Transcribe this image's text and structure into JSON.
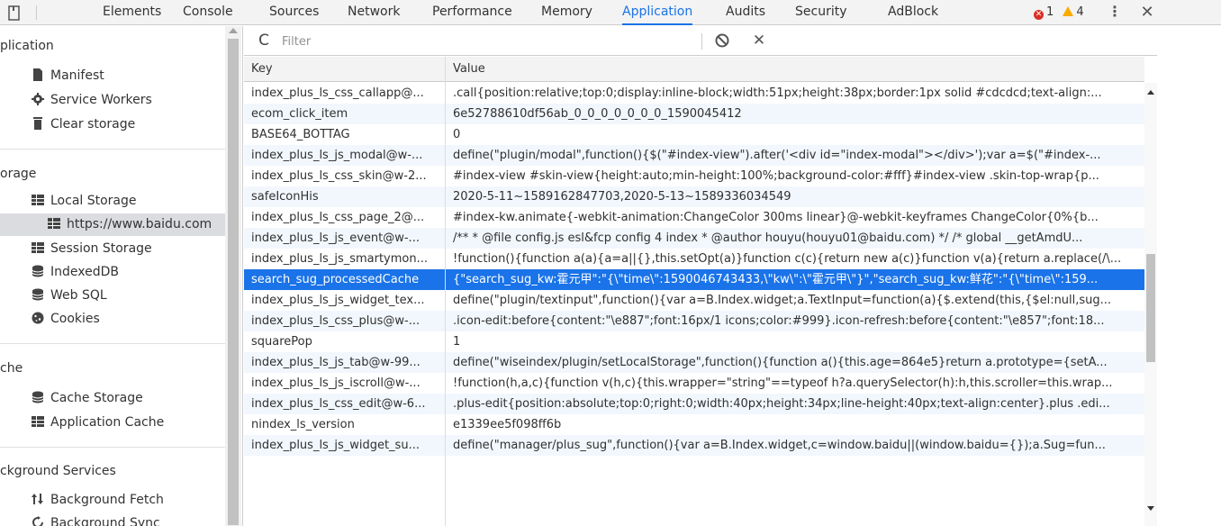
{
  "toolbar": {
    "tabs": [
      {
        "label": "Elements",
        "left": 0
      },
      {
        "label": "Console",
        "left": 0
      },
      {
        "label": "Sources",
        "left": 0
      },
      {
        "label": "Network",
        "left": 0
      },
      {
        "label": "Performance",
        "left": 0
      },
      {
        "label": "Memory",
        "left": 0
      },
      {
        "label": "Application",
        "left": 0
      },
      {
        "label": "Audits",
        "left": 0
      },
      {
        "label": "Security",
        "left": 0
      },
      {
        "label": "AdBlock",
        "left": 0
      }
    ],
    "active_tab": "Application",
    "error_count": "1",
    "warning_count": "4",
    "colors": {
      "accent": "#1a73e8",
      "error": "#d93025",
      "warning": "#f9ab00"
    }
  },
  "sidebar": {
    "sections": {
      "application": "plication",
      "storage": "orage",
      "cache": "che",
      "background_services": "ckground Services"
    },
    "items": {
      "manifest": "Manifest",
      "service_workers": "Service Workers",
      "clear_storage": "Clear storage",
      "local_storage": "Local Storage",
      "baidu_origin": "https://www.baidu.com",
      "session_storage": "Session Storage",
      "indexeddb": "IndexedDB",
      "web_sql": "Web SQL",
      "cookies": "Cookies",
      "cache_storage": "Cache Storage",
      "application_cache": "Application Cache",
      "background_fetch": "Background Fetch",
      "background_sync": "Background Sync"
    }
  },
  "filter": {
    "placeholder": "Filter"
  },
  "table": {
    "headers": {
      "key": "Key",
      "value": "Value"
    },
    "selected_index": 11,
    "rows": [
      {
        "key": "index_plus_ls_css_callapp@...",
        "value": ".call{position:relative;top:0;display:inline-block;width:51px;height:38px;border:1px solid #cdcdcd;text-align:..."
      },
      {
        "key": "ecom_click_item",
        "value": "6e52788610df56ab_0_0_0_0_0_0_0_1590045412"
      },
      {
        "key": "BASE64_BOTTAG",
        "value": "0"
      },
      {
        "key": "index_plus_ls_js_modal@w-...",
        "value": "define(\"plugin/modal\",function(){$(\"#index-view\").after('<div id=\"index-modal\"></div>');var a=$(\"#index-..."
      },
      {
        "key": "index_plus_ls_css_skin@w-2...",
        "value": "#index-view #skin-view{height:auto;min-height:100%;background-color:#fff}#index-view .skin-top-wrap{p..."
      },
      {
        "key": "safeIconHis",
        "value": "2020-5-11~1589162847703,2020-5-13~1589336034549"
      },
      {
        "key": "index_plus_ls_css_page_2@...",
        "value": "#index-kw.animate{-webkit-animation:ChangeColor 300ms linear}@-webkit-keyframes ChangeColor{0%{b..."
      },
      {
        "key": "index_plus_ls_js_event@w-...",
        "value": "/** * @file config.js esl&fcp config 4 index * @author houyu(houyu01@baidu.com) */ /* global __getAmdU..."
      },
      {
        "key": "index_plus_ls_js_smartymon...",
        "value": "!function(){function a(a){a=a||{},this.setOpt(a)}function c(c){return new a(c)}function v(a){return a.replace(/\\..."
      },
      {
        "key": "search_sug_processedCache",
        "value": "{\"search_sug_kw:霍元甲\":\"{\\\"time\\\":1590046743433,\\\"kw\\\":\\\"霍元甲\\\"}\",\"search_sug_kw:鲜花\":\"{\\\"time\\\":159..."
      },
      {
        "key": "index_plus_ls_js_widget_tex...",
        "value": "define(\"plugin/textinput\",function(){var a=B.Index.widget;a.TextInput=function(a){$.extend(this,{$el:null,sug..."
      },
      {
        "key": "index_plus_ls_css_plus@w-...",
        "value": ".icon-edit:before{content:\"\\e887\";font:16px/1 icons;color:#999}.icon-refresh:before{content:\"\\e857\";font:18..."
      },
      {
        "key": "squarePop",
        "value": "1"
      },
      {
        "key": "index_plus_ls_js_tab@w-99...",
        "value": "define(\"wiseindex/plugin/setLocalStorage\",function(){function a(){this.age=864e5}return a.prototype={setA..."
      },
      {
        "key": "index_plus_ls_js_iscroll@w-...",
        "value": "!function(h,a,c){function v(h,c){this.wrapper=\"string\"==typeof h?a.querySelector(h):h,this.scroller=this.wrap..."
      },
      {
        "key": "index_plus_ls_css_edit@w-6...",
        "value": ".plus-edit{position:absolute;top:0;right:0;width:40px;height:34px;line-height:40px;text-align:center}.plus .edi..."
      },
      {
        "key": "nindex_ls_version",
        "value": "e1339ee5f098ff6b"
      },
      {
        "key": "index_plus_ls_js_widget_su...",
        "value": "define(\"manager/plus_sug\",function(){var a=B.Index.widget,c=window.baidu||(window.baidu={});a.Sug=fun..."
      }
    ]
  }
}
